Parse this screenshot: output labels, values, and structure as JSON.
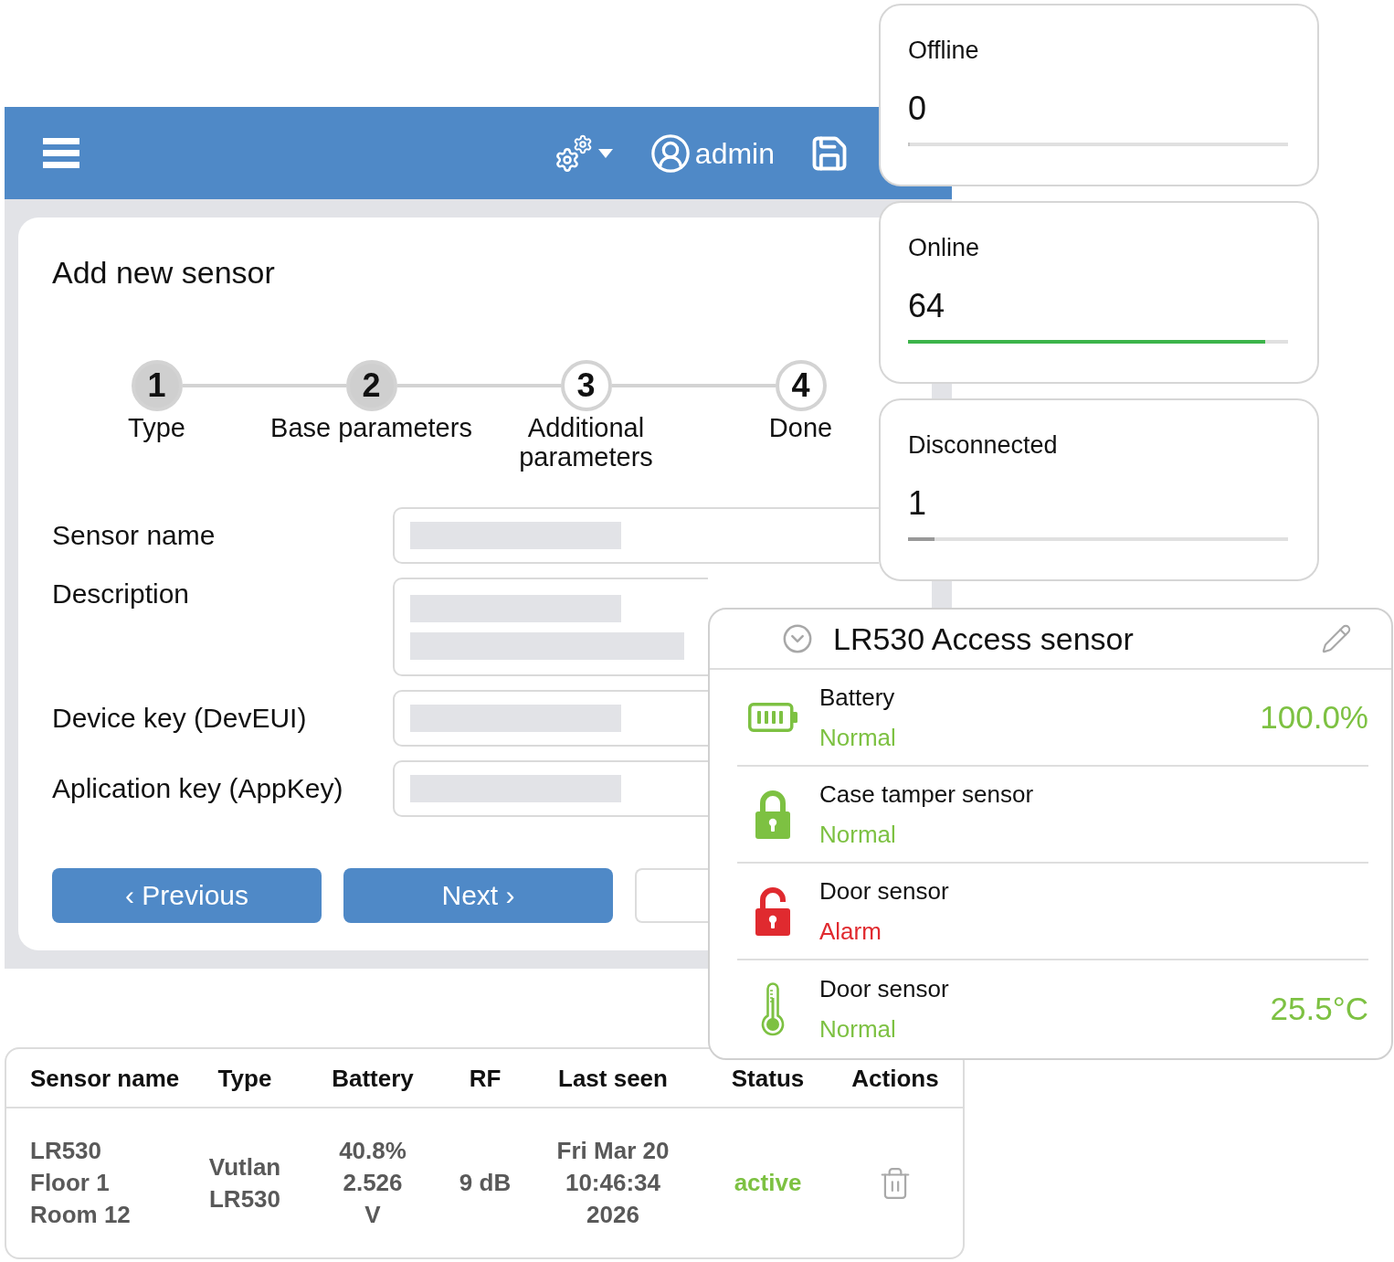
{
  "header": {
    "user": "admin"
  },
  "form_card": {
    "title": "Add new sensor",
    "steps": [
      {
        "number": "1",
        "label": "Type",
        "completed": true
      },
      {
        "number": "2",
        "label": "Base parameters",
        "completed": true
      },
      {
        "number": "3",
        "label": "Additional parameters",
        "completed": false
      },
      {
        "number": "4",
        "label": "Done",
        "completed": false
      }
    ],
    "fields": [
      {
        "label": "Sensor name",
        "kind": "text"
      },
      {
        "label": "Description",
        "kind": "textarea"
      },
      {
        "label": "Device key (DevEUI)",
        "kind": "text"
      },
      {
        "label": "Aplication key (AppKey)",
        "kind": "text"
      }
    ],
    "buttons": [
      {
        "label": "‹ Previous",
        "kind": "primary"
      },
      {
        "label": "Next ›",
        "kind": "primary"
      },
      {
        "kind": "outline"
      }
    ]
  },
  "status_cards": [
    {
      "label": "Offline",
      "value": "0",
      "level": 0
    },
    {
      "label": "Online",
      "value": "64",
      "level": 0.94,
      "color": "#3cb44a"
    },
    {
      "label": "Disconnected",
      "value": "1",
      "level": 0.07,
      "color": "#999999"
    }
  ],
  "sensor_card": {
    "title": "LR530 Access sensor",
    "rows": [
      {
        "kind": "battery",
        "label": "Battery",
        "status": "Normal",
        "alarm": false,
        "value": "100.0%"
      },
      {
        "kind": "lock",
        "label": "Case tamper sensor",
        "status": "Normal",
        "alarm": false
      },
      {
        "kind": "lock",
        "label": "Door sensor",
        "status": "Alarm",
        "alarm": true
      },
      {
        "kind": "thermometer",
        "label": "Door sensor",
        "status": "Normal",
        "alarm": false,
        "value": "25.5°C"
      }
    ]
  },
  "table": {
    "columns": [
      "Sensor name",
      "Type",
      "Battery",
      "RF",
      "Last seen",
      "Status",
      "Actions"
    ],
    "rows": [
      {
        "cells": [
          "LR530\nFloor 1\nRoom 12",
          "Vutlan\nLR530",
          "40.8%\n2.526\nV",
          "9 dB",
          "Fri Mar 20\n10:46:34\n2026"
        ],
        "status": "active",
        "active": true
      }
    ]
  }
}
